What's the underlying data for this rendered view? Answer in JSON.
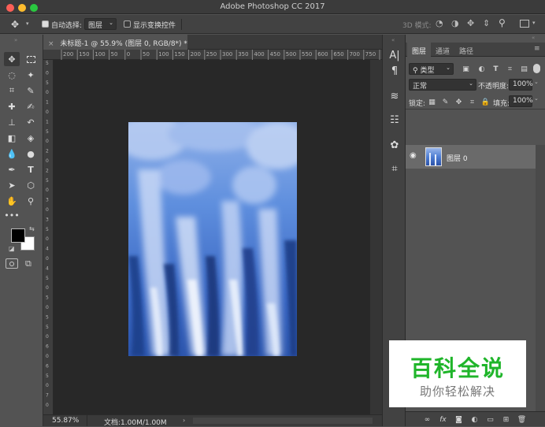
{
  "window": {
    "title": "Adobe Photoshop CC 2017"
  },
  "options_bar": {
    "auto_select_label": "自动选择:",
    "auto_select_value": "图层",
    "show_transform_label": "显示变换控件",
    "mode_3d_label": "3D 模式:"
  },
  "document": {
    "tab_title": "未标题-1 @ 55.9% (图层 0, RGB/8*) *",
    "zoom": "55.87%",
    "doc_info": "文档:1.00M/1.00M"
  },
  "rulers": {
    "top": [
      "200",
      "150",
      "100",
      "50",
      "0",
      "50",
      "100",
      "150",
      "200",
      "250",
      "300",
      "350",
      "400",
      "450",
      "500",
      "550",
      "600",
      "650",
      "700",
      "750"
    ],
    "left": [
      "5",
      "0",
      "5",
      "0",
      "1",
      "0",
      "1",
      "5",
      "0",
      "2",
      "0",
      "2",
      "5",
      "0",
      "3",
      "0",
      "3",
      "5",
      "0",
      "4",
      "0",
      "4",
      "5",
      "0",
      "5",
      "0",
      "5",
      "5",
      "0",
      "6",
      "0",
      "6",
      "5",
      "0",
      "7",
      "0"
    ]
  },
  "layers_panel": {
    "tabs": [
      "图层",
      "通道",
      "路径"
    ],
    "filter_label": "类型",
    "blend_mode": "正常",
    "opacity_label": "不透明度:",
    "opacity_value": "100%",
    "lock_label": "锁定:",
    "fill_label": "填充:",
    "fill_value": "100%",
    "layers": [
      {
        "name": "图层 0",
        "visible": true
      }
    ]
  },
  "watermark": {
    "title": "百科全说",
    "subtitle": "助你轻松解决"
  },
  "colors": {
    "accent_green": "#1fb52a",
    "foreground": "#000000",
    "background": "#ffffff"
  }
}
